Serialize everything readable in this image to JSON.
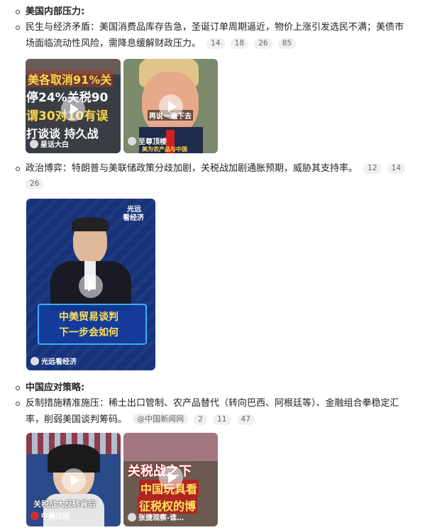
{
  "section1": {
    "heading": "美国内部压力:",
    "item1": {
      "line1": "民生与经济矛盾：美国消费品库存告急，圣诞订单周期逼近，物价上涨引发选民不满；美债市",
      "line2": "场面临流动性风险，需降息缓解财政压力。",
      "citations": [
        "14",
        "18",
        "26",
        "85"
      ]
    },
    "videos1": [
      {
        "overlay": [
          "美各取消91%关",
          "停24%关税90",
          "谓30对10有误",
          "打谈谈 持久战"
        ],
        "channel": "星话大白"
      },
      {
        "subtitle": "再说一遍下去",
        "channel": "至尊顶楼",
        "caption": "美为农产品与中国"
      }
    ],
    "item2": {
      "line1": "政治博弈：特朗普与美联储政策分歧加剧，关税战加剧通胀预期，威胁其支持率。",
      "citations_line1": [
        "12",
        "14"
      ],
      "citations_line2": [
        "26"
      ]
    },
    "video2": {
      "top_text": [
        "光远",
        "看经济"
      ],
      "banner": [
        "中美贸易谈判",
        "下一步会如何"
      ],
      "channel": "光远看经济"
    }
  },
  "section2": {
    "heading": "中国应对策略:",
    "item1": {
      "line1": "反制措施精准施压：稀土出口管制、农产品替代（转向巴西、阿根廷等）、金融组合拳稳定汇",
      "line2": "率，削弱美国谈判筹码。",
      "source": "@中国新闻网",
      "citations": [
        "2",
        "11",
        "47"
      ]
    },
    "videos": [
      {
        "caption": "关税战大反转背后",
        "channel": "中美过招"
      },
      {
        "overlay": [
          "关税战之下",
          "中国玩具看",
          "征税权的博"
        ],
        "channel": "张捷观察-谁…"
      }
    ]
  }
}
